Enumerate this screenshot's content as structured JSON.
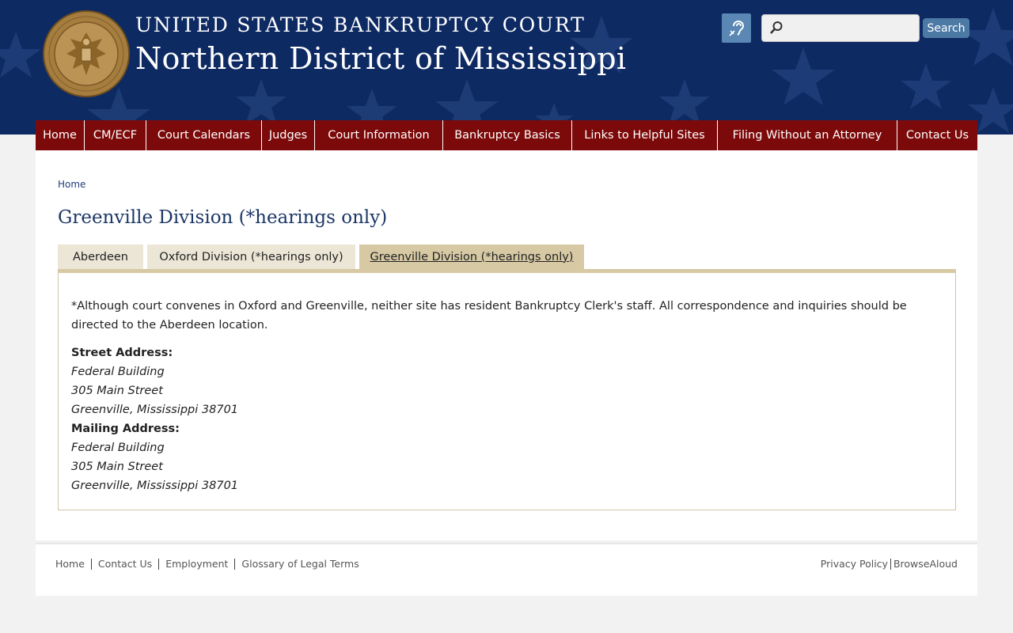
{
  "header": {
    "court_line1": "UNITED STATES BANKRUPTCY COURT",
    "court_line2": "Northern District of Mississippi",
    "seal_text": "UNITED STATES BANKRUPTCY COURT NORTHERN DISTRICT OF MISSISSIPPI",
    "search_placeholder": "",
    "search_button": "Search"
  },
  "nav": {
    "items": [
      {
        "label": "Home"
      },
      {
        "label": "CM/ECF"
      },
      {
        "label": "Court Calendars"
      },
      {
        "label": "Judges"
      },
      {
        "label": "Court Information"
      },
      {
        "label": "Bankruptcy Basics"
      },
      {
        "label": "Links to Helpful Sites"
      },
      {
        "label": "Filing Without an Attorney"
      },
      {
        "label": "Contact Us"
      }
    ]
  },
  "breadcrumb": {
    "home": "Home"
  },
  "page": {
    "title": "Greenville Division (*hearings only)"
  },
  "tabs": [
    {
      "label": "Aberdeen",
      "active": false
    },
    {
      "label": "Oxford Division (*hearings only)",
      "active": false
    },
    {
      "label": "Greenville Division (*hearings only)",
      "active": true
    }
  ],
  "content": {
    "notice": "*Although court convenes in Oxford and Greenville, neither site has resident Bankruptcy Clerk's staff. All correspondence and inquiries should be directed to the Aberdeen location.",
    "street_label": "Street Address:",
    "street": [
      "Federal Building",
      "305 Main Street",
      "Greenville, Mississippi 38701"
    ],
    "mailing_label": "Mailing Address:",
    "mailing": [
      "Federal Building",
      "305 Main Street",
      "Greenville, Mississippi 38701"
    ]
  },
  "footer": {
    "left_links": [
      "Home",
      "Contact Us",
      "Employment",
      "Glossary of Legal Terms"
    ],
    "right_links": [
      "Privacy Policy",
      "BrowseAloud"
    ]
  },
  "colors": {
    "header_bg": "#0e2a63",
    "nav_bg": "#7c0a0a",
    "tab_active": "#d6c9a4",
    "tab_inactive": "#ece6d6",
    "title": "#1c3766"
  }
}
